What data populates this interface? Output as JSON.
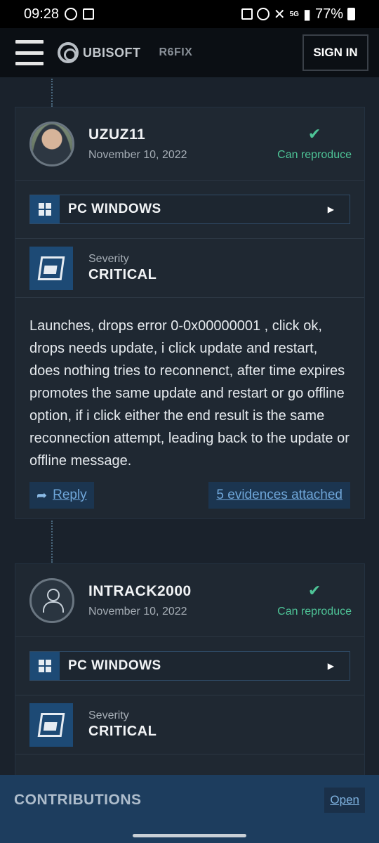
{
  "status_bar": {
    "time": "09:28",
    "battery": "77%",
    "net_label": "5G"
  },
  "header": {
    "brand": "UBISOFT",
    "section": "R6FIX",
    "signin_label": "SIGN IN"
  },
  "reports": [
    {
      "username": "UZUZ11",
      "date": "November 10, 2022",
      "status": "Can reproduce",
      "platform": "PC WINDOWS",
      "severity_label": "Severity",
      "severity_value": "CRITICAL",
      "description": "Launches, drops error 0-0x00000001 , click ok, drops needs update, i click update and restart, does nothing tries to reconnenct, after time expires promotes the same update and restart or go offline option, if i click either the end result is the same reconnection attempt, leading back to the update or offline message.",
      "reply_label": "Reply",
      "evidence_label": "5 evidences attached"
    },
    {
      "username": "INTRACK2000",
      "date": "November 10, 2022",
      "status": "Can reproduce",
      "platform": "PC WINDOWS",
      "severity_label": "Severity",
      "severity_value": "CRITICAL"
    }
  ],
  "contributions": {
    "title": "CONTRIBUTIONS",
    "open_label": "Open"
  },
  "colors": {
    "accent_green": "#4ec497",
    "link_blue": "#6fa6d9",
    "panel_blue": "#1d4a75"
  }
}
